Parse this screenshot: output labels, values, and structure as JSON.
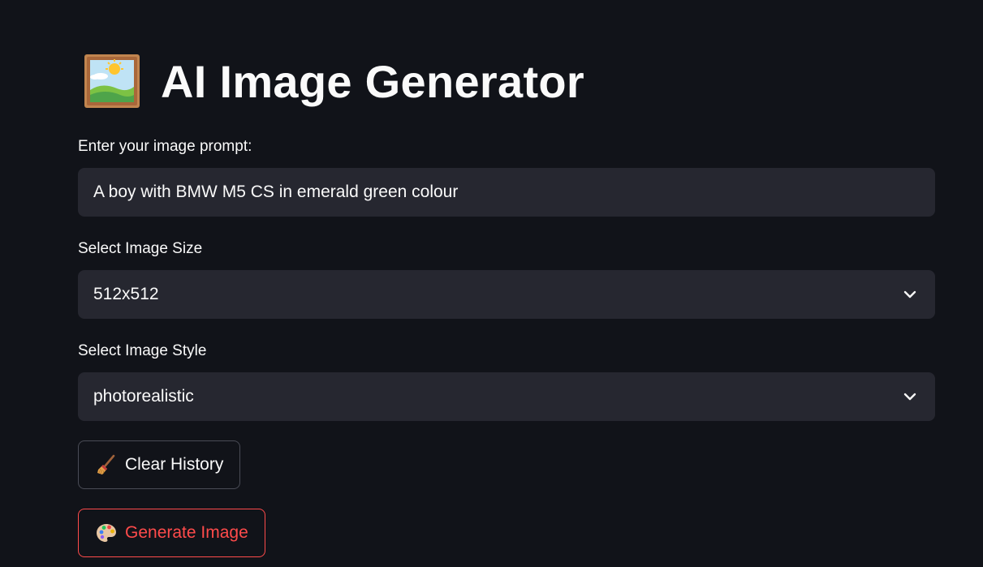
{
  "app": {
    "title": "AI Image Generator",
    "title_icon": "framed-picture-icon"
  },
  "prompt": {
    "label": "Enter your image prompt:",
    "value": "A boy with BMW M5 CS in emerald green colour"
  },
  "size_select": {
    "label": "Select Image Size",
    "selected": "512x512"
  },
  "style_select": {
    "label": "Select Image Style",
    "selected": "photorealistic"
  },
  "buttons": {
    "clear_label": "Clear History",
    "clear_icon": "broom-icon",
    "generate_label": "Generate Image",
    "generate_icon": "palette-icon"
  },
  "colors": {
    "background": "#111319",
    "field_bg": "#262730",
    "accent": "#ff4b4b",
    "text": "#fafafa"
  }
}
